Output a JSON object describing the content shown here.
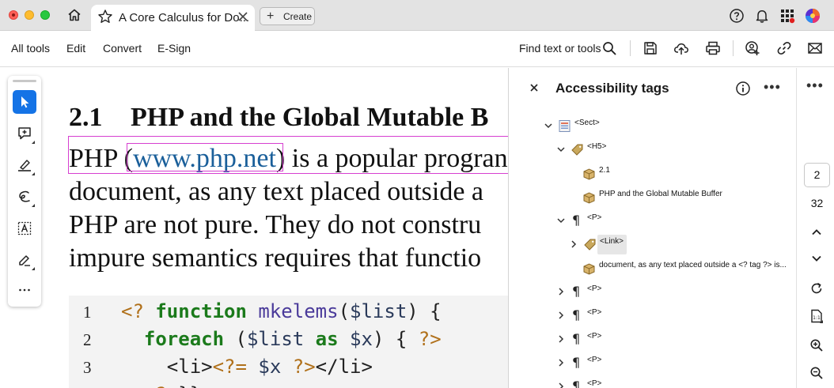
{
  "tab": {
    "title": "A Core Calculus for Do..."
  },
  "toolbar": {
    "create_label": "Create"
  },
  "menu": {
    "all_tools": "All tools",
    "edit": "Edit",
    "convert": "Convert",
    "esign": "E-Sign",
    "find_label": "Find text or tools"
  },
  "document": {
    "section_number": "2.1",
    "section_title": "PHP and the Global Mutable B",
    "line1_before": "PHP (",
    "line1_link": "www.php.net",
    "line1_after": ") is a popular progran",
    "line2": "document, as any text placed outside a",
    "line3": "PHP are not pure. They do not constru",
    "line4": "impure semantics requires that functio",
    "code": [
      {
        "num": "1"
      },
      {
        "num": "2"
      },
      {
        "num": "3"
      }
    ]
  },
  "panel": {
    "title": "Accessibility tags",
    "items": [
      {
        "label": "<Sect>"
      },
      {
        "label": "<H5>"
      },
      {
        "label": "2.1"
      },
      {
        "label": "PHP and the Global Mutable Buffer"
      },
      {
        "label": "<P>"
      },
      {
        "label": "<Link>"
      },
      {
        "label": "document, as any text placed outside a <? tag ?> is..."
      },
      {
        "label": "<P>"
      },
      {
        "label": "<P>"
      },
      {
        "label": "<P>"
      },
      {
        "label": "<P>"
      },
      {
        "label": "<P>"
      }
    ]
  },
  "rail": {
    "current_page": "2",
    "total_pages": "32"
  }
}
